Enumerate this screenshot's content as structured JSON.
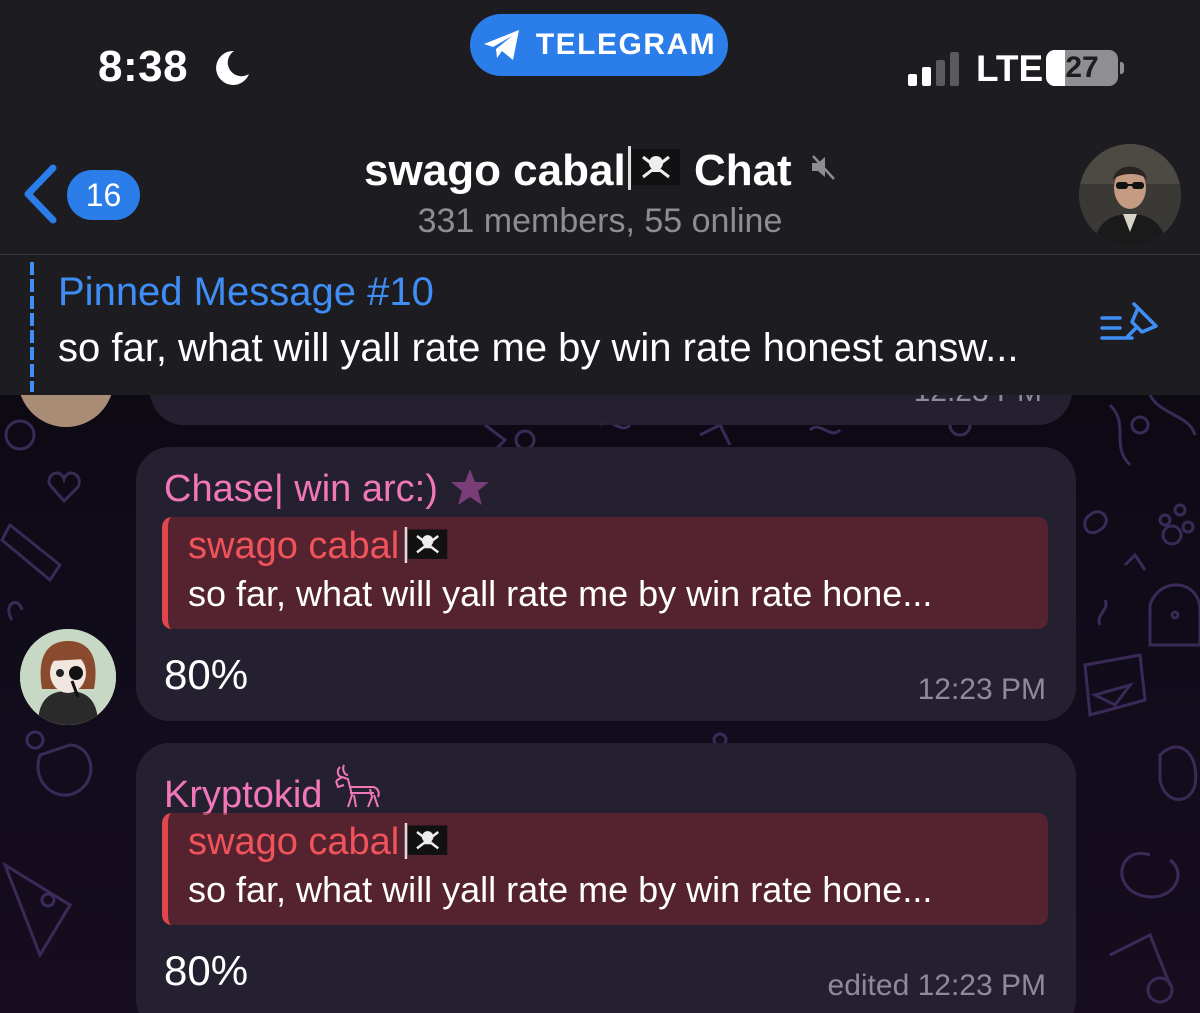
{
  "status_bar": {
    "time": "8:38",
    "app_pill": "TELEGRAM",
    "network": "LTE",
    "battery": "27",
    "battery_level": 0.27
  },
  "header": {
    "back_count": "16",
    "title": "swago cabal",
    "title_suffix": "Chat",
    "subtitle": "331 members, 55 online"
  },
  "pinned": {
    "label": "Pinned Message #10",
    "text": "so far, what will yall rate me by win rate honest answ..."
  },
  "messages": [
    {
      "time": "12:23 PM"
    },
    {
      "sender": "Chase| win arc:)",
      "reply_name": "swago cabal",
      "reply_text": "so far, what will yall rate me by win rate hone...",
      "text": "80%",
      "time": "12:23 PM"
    },
    {
      "sender": "Kryptokid",
      "reply_name": "swago cabal",
      "reply_text": "so far, what will yall rate me by win rate hone...",
      "text": "80%",
      "time": "edited 12:23 PM"
    }
  ],
  "colors": {
    "accent": "#2b7de9",
    "sender_name": "#f277b9",
    "reply_name": "#f0535a",
    "bubble": "#262131"
  },
  "icons": [
    "moon-icon",
    "telegram-plane-icon",
    "signal-icon",
    "back-chevron-icon",
    "pirate-flag-icon",
    "muted-speaker-icon",
    "pinned-list-icon",
    "star-icon",
    "goat-icon"
  ]
}
